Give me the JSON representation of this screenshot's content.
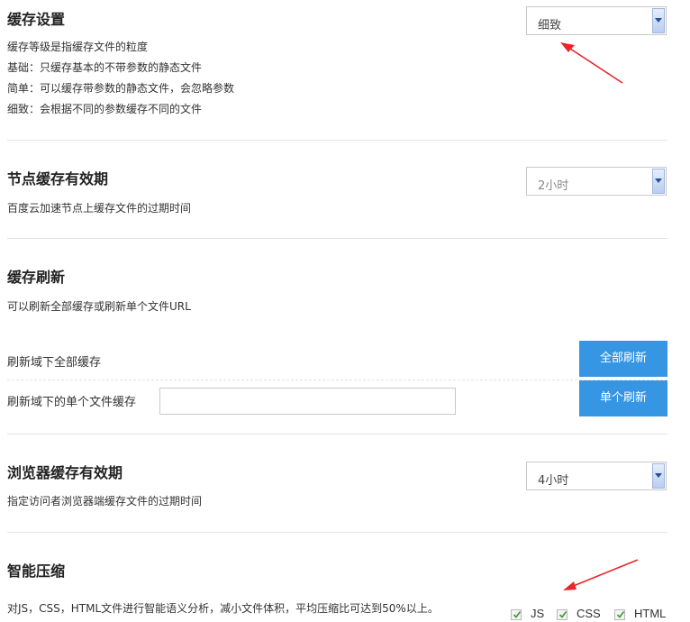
{
  "cache_level": {
    "title": "缓存设置",
    "desc": [
      "缓存等级是指缓存文件的粒度",
      "基础：只缓存基本的不带参数的静态文件",
      "简单：可以缓存带参数的静态文件，会忽略参数",
      "细致：会根据不同的参数缓存不同的文件"
    ],
    "selected": "细致"
  },
  "node_cache": {
    "title": "节点缓存有效期",
    "desc": "百度云加速节点上缓存文件的过期时间",
    "selected": "2小时"
  },
  "cache_refresh": {
    "title": "缓存刷新",
    "desc": "可以刷新全部缓存或刷新单个文件URL",
    "refresh_all_label": "刷新域下全部缓存",
    "refresh_all_button": "全部刷新",
    "refresh_single_label": "刷新域下的单个文件缓存",
    "refresh_single_value": "",
    "refresh_single_button": "单个刷新"
  },
  "browser_cache": {
    "title": "浏览器缓存有效期",
    "desc": "指定访问者浏览器端缓存文件的过期时间",
    "selected": "4小时"
  },
  "compression": {
    "title": "智能压缩",
    "desc": "对JS，CSS，HTML文件进行智能语义分析，减小文件体积，平均压缩比可达到50%以上。",
    "options": [
      {
        "label": "JS",
        "checked": true
      },
      {
        "label": "CSS",
        "checked": true
      },
      {
        "label": "HTML",
        "checked": true
      }
    ]
  },
  "colors": {
    "accent_button": "#3796e4",
    "annotation_arrow": "#e8262a"
  }
}
